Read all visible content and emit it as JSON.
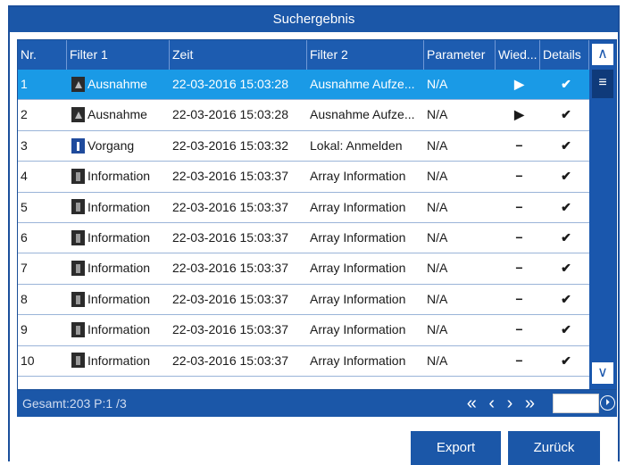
{
  "title": "Suchergebnis",
  "columns": [
    "Nr.",
    "Filter 1",
    "Zeit",
    "Filter 2",
    "Parameter",
    "Wied...",
    "Details"
  ],
  "rows": [
    {
      "nr": "1",
      "icon": "alarm",
      "filter1": "Ausnahme",
      "zeit": "22-03-2016 15:03:28",
      "filter2": "Ausnahme Aufze...",
      "param": "N/A",
      "wied": "▶",
      "details": "✔"
    },
    {
      "nr": "2",
      "icon": "alarm",
      "filter1": "Ausnahme",
      "zeit": "22-03-2016 15:03:28",
      "filter2": "Ausnahme Aufze...",
      "param": "N/A",
      "wied": "▶",
      "details": "✔"
    },
    {
      "nr": "3",
      "icon": "op",
      "filter1": "Vorgang",
      "zeit": "22-03-2016 15:03:32",
      "filter2": "Lokal: Anmelden",
      "param": "N/A",
      "wied": "−",
      "details": "✔"
    },
    {
      "nr": "4",
      "icon": "info",
      "filter1": "Information",
      "zeit": "22-03-2016 15:03:37",
      "filter2": "Array Information",
      "param": "N/A",
      "wied": "−",
      "details": "✔"
    },
    {
      "nr": "5",
      "icon": "info",
      "filter1": "Information",
      "zeit": "22-03-2016 15:03:37",
      "filter2": "Array Information",
      "param": "N/A",
      "wied": "−",
      "details": "✔"
    },
    {
      "nr": "6",
      "icon": "info",
      "filter1": "Information",
      "zeit": "22-03-2016 15:03:37",
      "filter2": "Array Information",
      "param": "N/A",
      "wied": "−",
      "details": "✔"
    },
    {
      "nr": "7",
      "icon": "info",
      "filter1": "Information",
      "zeit": "22-03-2016 15:03:37",
      "filter2": "Array Information",
      "param": "N/A",
      "wied": "−",
      "details": "✔"
    },
    {
      "nr": "8",
      "icon": "info",
      "filter1": "Information",
      "zeit": "22-03-2016 15:03:37",
      "filter2": "Array Information",
      "param": "N/A",
      "wied": "−",
      "details": "✔"
    },
    {
      "nr": "9",
      "icon": "info",
      "filter1": "Information",
      "zeit": "22-03-2016 15:03:37",
      "filter2": "Array Information",
      "param": "N/A",
      "wied": "−",
      "details": "✔"
    },
    {
      "nr": "10",
      "icon": "info",
      "filter1": "Information",
      "zeit": "22-03-2016 15:03:37",
      "filter2": "Array Information",
      "param": "N/A",
      "wied": "−",
      "details": "✔"
    }
  ],
  "selected_row": 0,
  "footer": {
    "total": "Gesamt:203 P:1 /3",
    "pager": "« ‹ › »",
    "page_input": "",
    "go": "⏵"
  },
  "scrollbar": {
    "up": "∧",
    "thumb": "≡",
    "down": "∨"
  },
  "buttons": {
    "export": "Export",
    "back": "Zurück"
  },
  "colors": {
    "titlebar": "#1b57a8",
    "selected": "#1a9ae6",
    "header": "#1d5cb0"
  }
}
